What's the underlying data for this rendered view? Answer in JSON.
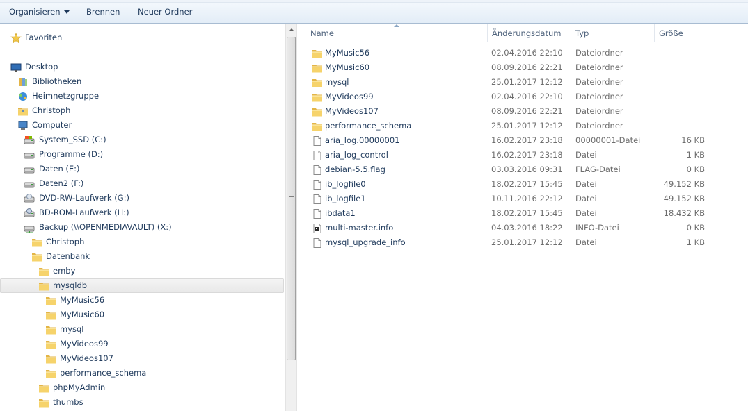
{
  "toolbar": {
    "organize": "Organisieren",
    "burn": "Brennen",
    "new_folder": "Neuer Ordner"
  },
  "nav": {
    "items": [
      {
        "label": "Favoriten",
        "icon": "star-icon"
      },
      {
        "label": "Desktop",
        "icon": "desktop-icon"
      },
      {
        "label": "Bibliotheken",
        "icon": "library-icon"
      },
      {
        "label": "Heimnetzgruppe",
        "icon": "homegroup-icon"
      },
      {
        "label": "Christoph",
        "icon": "user-folder-icon"
      },
      {
        "label": "Computer",
        "icon": "computer-icon"
      },
      {
        "label": "System_SSD (C:)",
        "icon": "system-drive-icon"
      },
      {
        "label": "Programme (D:)",
        "icon": "drive-icon"
      },
      {
        "label": "Daten (E:)",
        "icon": "drive-icon"
      },
      {
        "label": "Daten2 (F:)",
        "icon": "drive-icon"
      },
      {
        "label": "DVD-RW-Laufwerk (G:)",
        "icon": "dvd-drive-icon"
      },
      {
        "label": "BD-ROM-Laufwerk (H:)",
        "icon": "bd-drive-icon"
      },
      {
        "label": "Backup (\\\\OPENMEDIAVAULT) (X:)",
        "icon": "network-drive-icon"
      },
      {
        "label": "Christoph",
        "icon": "folder-icon"
      },
      {
        "label": "Datenbank",
        "icon": "folder-icon"
      },
      {
        "label": "emby",
        "icon": "folder-icon"
      },
      {
        "label": "mysqldb",
        "icon": "folder-icon"
      },
      {
        "label": "MyMusic56",
        "icon": "folder-icon"
      },
      {
        "label": "MyMusic60",
        "icon": "folder-icon"
      },
      {
        "label": "mysql",
        "icon": "folder-icon"
      },
      {
        "label": "MyVideos99",
        "icon": "folder-icon"
      },
      {
        "label": "MyVideos107",
        "icon": "folder-icon"
      },
      {
        "label": "performance_schema",
        "icon": "folder-icon"
      },
      {
        "label": "phpMyAdmin",
        "icon": "folder-icon"
      },
      {
        "label": "thumbs",
        "icon": "folder-icon"
      }
    ]
  },
  "list": {
    "columns": {
      "name": "Name",
      "date": "Änderungsdatum",
      "type": "Typ",
      "size": "Größe"
    },
    "rows": [
      {
        "name": "MyMusic56",
        "date": "02.04.2016 22:10",
        "type": "Dateiordner",
        "size": "",
        "icon": "folder-icon"
      },
      {
        "name": "MyMusic60",
        "date": "08.09.2016 22:21",
        "type": "Dateiordner",
        "size": "",
        "icon": "folder-icon"
      },
      {
        "name": "mysql",
        "date": "25.01.2017 12:12",
        "type": "Dateiordner",
        "size": "",
        "icon": "folder-icon"
      },
      {
        "name": "MyVideos99",
        "date": "02.04.2016 22:10",
        "type": "Dateiordner",
        "size": "",
        "icon": "folder-icon"
      },
      {
        "name": "MyVideos107",
        "date": "08.09.2016 22:21",
        "type": "Dateiordner",
        "size": "",
        "icon": "folder-icon"
      },
      {
        "name": "performance_schema",
        "date": "25.01.2017 12:12",
        "type": "Dateiordner",
        "size": "",
        "icon": "folder-icon"
      },
      {
        "name": "aria_log.00000001",
        "date": "16.02.2017 23:18",
        "type": "00000001-Datei",
        "size": "16 KB",
        "icon": "file-icon"
      },
      {
        "name": "aria_log_control",
        "date": "16.02.2017 23:18",
        "type": "Datei",
        "size": "1 KB",
        "icon": "file-icon"
      },
      {
        "name": "debian-5.5.flag",
        "date": "03.03.2016 09:31",
        "type": "FLAG-Datei",
        "size": "0 KB",
        "icon": "file-icon"
      },
      {
        "name": "ib_logfile0",
        "date": "18.02.2017 15:45",
        "type": "Datei",
        "size": "49.152 KB",
        "icon": "file-icon"
      },
      {
        "name": "ib_logfile1",
        "date": "10.11.2016 22:12",
        "type": "Datei",
        "size": "49.152 KB",
        "icon": "file-icon"
      },
      {
        "name": "ibdata1",
        "date": "18.02.2017 15:45",
        "type": "Datei",
        "size": "18.432 KB",
        "icon": "file-icon"
      },
      {
        "name": "multi-master.info",
        "date": "04.03.2016 18:22",
        "type": "INFO-Datei",
        "size": "0 KB",
        "icon": "info-file-icon"
      },
      {
        "name": "mysql_upgrade_info",
        "date": "25.01.2017 12:12",
        "type": "Datei",
        "size": "1 KB",
        "icon": "file-icon"
      }
    ]
  }
}
